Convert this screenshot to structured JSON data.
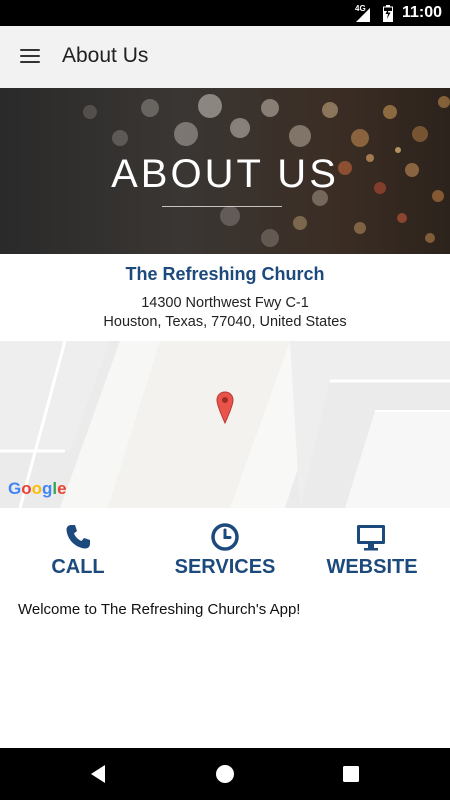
{
  "status_bar": {
    "network": "4G",
    "time": "11:00",
    "icons": [
      "signal-icon",
      "battery-icon"
    ]
  },
  "app_bar": {
    "menu_icon": "hamburger-menu-icon",
    "title": "About Us"
  },
  "hero": {
    "title": "ABOUT US"
  },
  "church": {
    "name": "The Refreshing Church",
    "address_line1": "14300 Northwest Fwy C-1",
    "address_line2": "Houston, Texas, 77040, United States"
  },
  "map": {
    "logo": "Google",
    "pin_icon": "map-pin-icon"
  },
  "actions": [
    {
      "label": "CALL",
      "icon": "phone-icon"
    },
    {
      "label": "SERVICES",
      "icon": "clock-icon"
    },
    {
      "label": "WEBSITE",
      "icon": "monitor-icon"
    }
  ],
  "welcome_text": "Welcome to The Refreshing Church's App!",
  "nav_bar": {
    "icons": [
      "back-icon",
      "home-icon",
      "recent-apps-icon"
    ]
  },
  "colors": {
    "accent": "#1d4a7c",
    "app_bar_bg": "#f2f2f2",
    "pin": "#e8544a"
  }
}
